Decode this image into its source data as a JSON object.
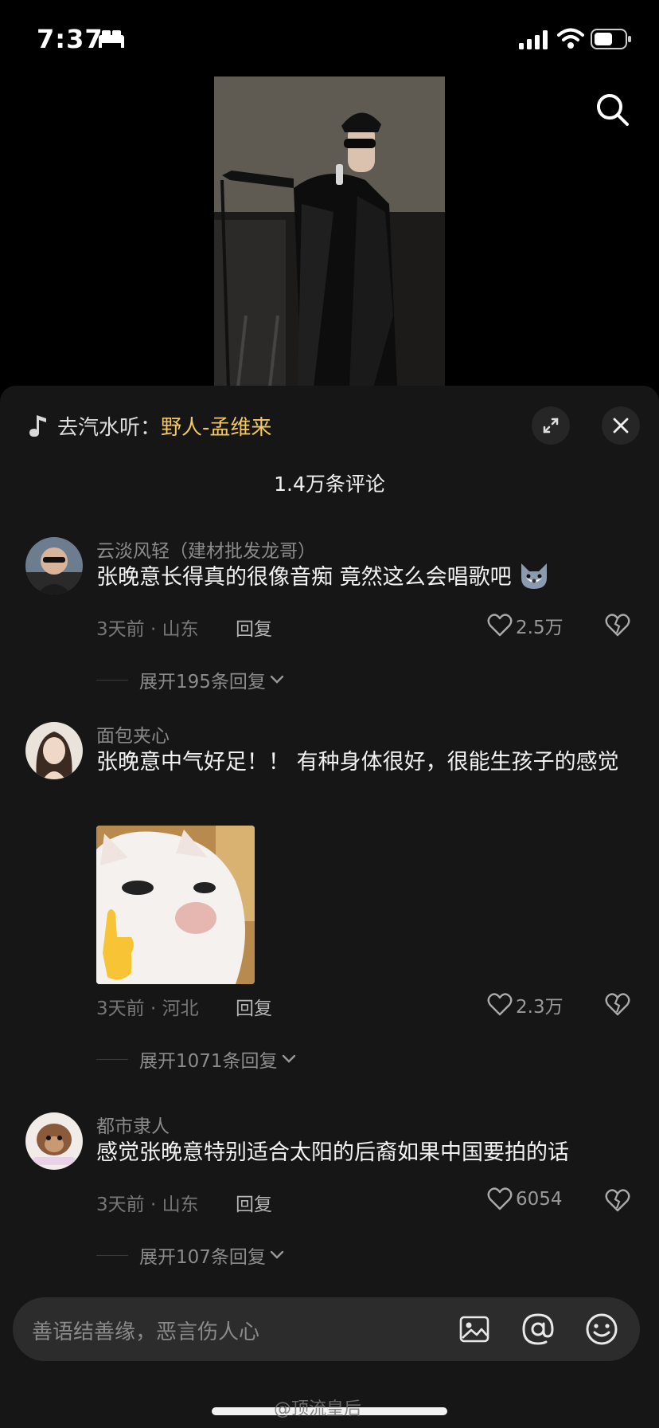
{
  "status_bar": {
    "time": "7:37"
  },
  "music": {
    "prefix": "去汽水听：",
    "song": "野人-孟维来"
  },
  "comments_header": {
    "count": "1.4万条评论"
  },
  "comments": [
    {
      "username": "云淡风轻（建材批发龙哥）",
      "text": "张晚意长得真的很像音痴 竟然这么会唱歌吧",
      "emoji_sticker": "wolf-emoji",
      "meta": "3天前 · 山东",
      "reply_label": "回复",
      "likes": "2.5万",
      "expand_label": "展开195条回复"
    },
    {
      "username": "面包夹心",
      "text": "张晚意中气好足！！ 有种身体很好，很能生孩子的感觉",
      "sticker": "cat-pointing-up",
      "meta": "3天前 · 河北",
      "reply_label": "回复",
      "likes": "2.3万",
      "expand_label": "展开1071条回复"
    },
    {
      "username": "都市隶人",
      "text": "感觉张晚意特别适合太阳的后裔如果中国要拍的话",
      "meta": "3天前 · 山东",
      "reply_label": "回复",
      "likes": "6054",
      "expand_label": "展开107条回复"
    }
  ],
  "input": {
    "placeholder": "善语结善缘，恶言伤人心"
  },
  "watermark": "@顶流皇后",
  "colors": {
    "accent": "#f3c860",
    "panel_bg": "#161616",
    "input_bg": "#2c2c2c"
  },
  "icons": [
    "bed-icon",
    "signal-icon",
    "wifi-icon",
    "battery-icon",
    "search-icon",
    "music-note-icon",
    "expand-icon",
    "close-icon",
    "heart-icon",
    "broken-heart-icon",
    "chevron-down-icon",
    "image-icon",
    "at-icon",
    "emoji-icon"
  ]
}
